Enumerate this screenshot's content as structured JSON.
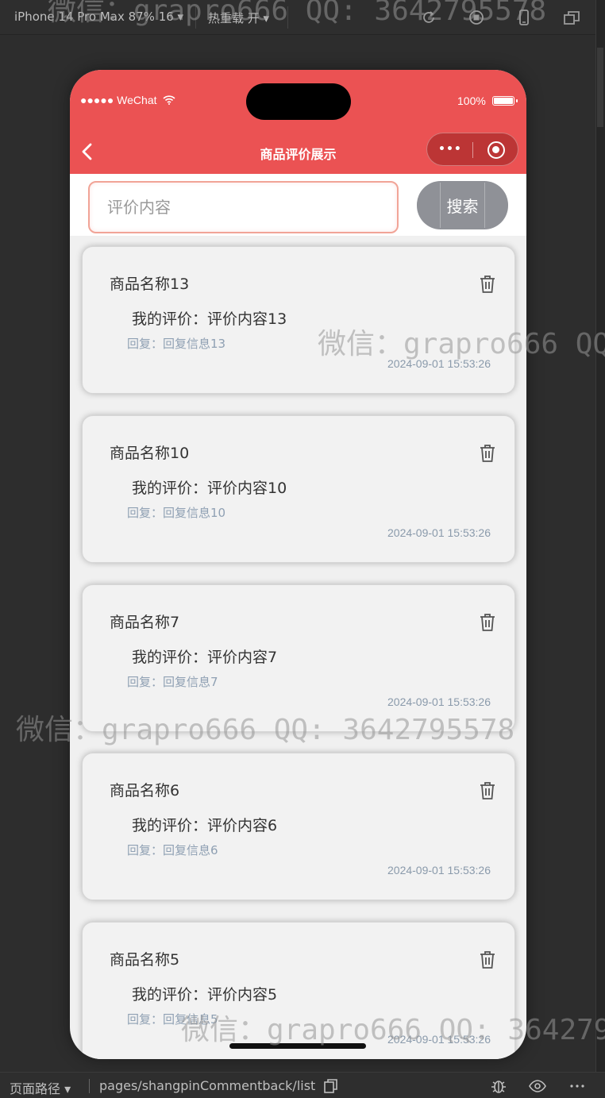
{
  "ide": {
    "device_label": "iPhone 14 Pro Max 87% 16 ▾",
    "hot_reload_label": "热重载 开 ▾",
    "page_path_label": "页面路径 ▾",
    "page_path": "pages/shangpinCommentback/list"
  },
  "watermark": "微信：grapro666 QQ: 3642795578",
  "status_bar": {
    "carrier": "●●●●● WeChat",
    "battery": "100%"
  },
  "navbar": {
    "title": "商品评价展示",
    "more_label": "•••"
  },
  "search": {
    "placeholder": "评价内容",
    "value": "",
    "button_label": "搜索"
  },
  "comments": [
    {
      "name": "商品名称13",
      "content": "我的评价：评价内容13",
      "reply": "回复：回复信息13",
      "time": "2024-09-01 15:53:26"
    },
    {
      "name": "商品名称10",
      "content": "我的评价：评价内容10",
      "reply": "回复：回复信息10",
      "time": "2024-09-01 15:53:26"
    },
    {
      "name": "商品名称7",
      "content": "我的评价：评价内容7",
      "reply": "回复：回复信息7",
      "time": "2024-09-01 15:53:26"
    },
    {
      "name": "商品名称6",
      "content": "我的评价：评价内容6",
      "reply": "回复：回复信息6",
      "time": "2024-09-01 15:53:26"
    },
    {
      "name": "商品名称5",
      "content": "我的评价：评价内容5",
      "reply": "回复：回复信息5",
      "time": "2024-09-01 15:53:26"
    }
  ],
  "colors": {
    "header": "#eb5253",
    "search_button": "#8f9197",
    "card_bg": "#f2f2f2"
  }
}
